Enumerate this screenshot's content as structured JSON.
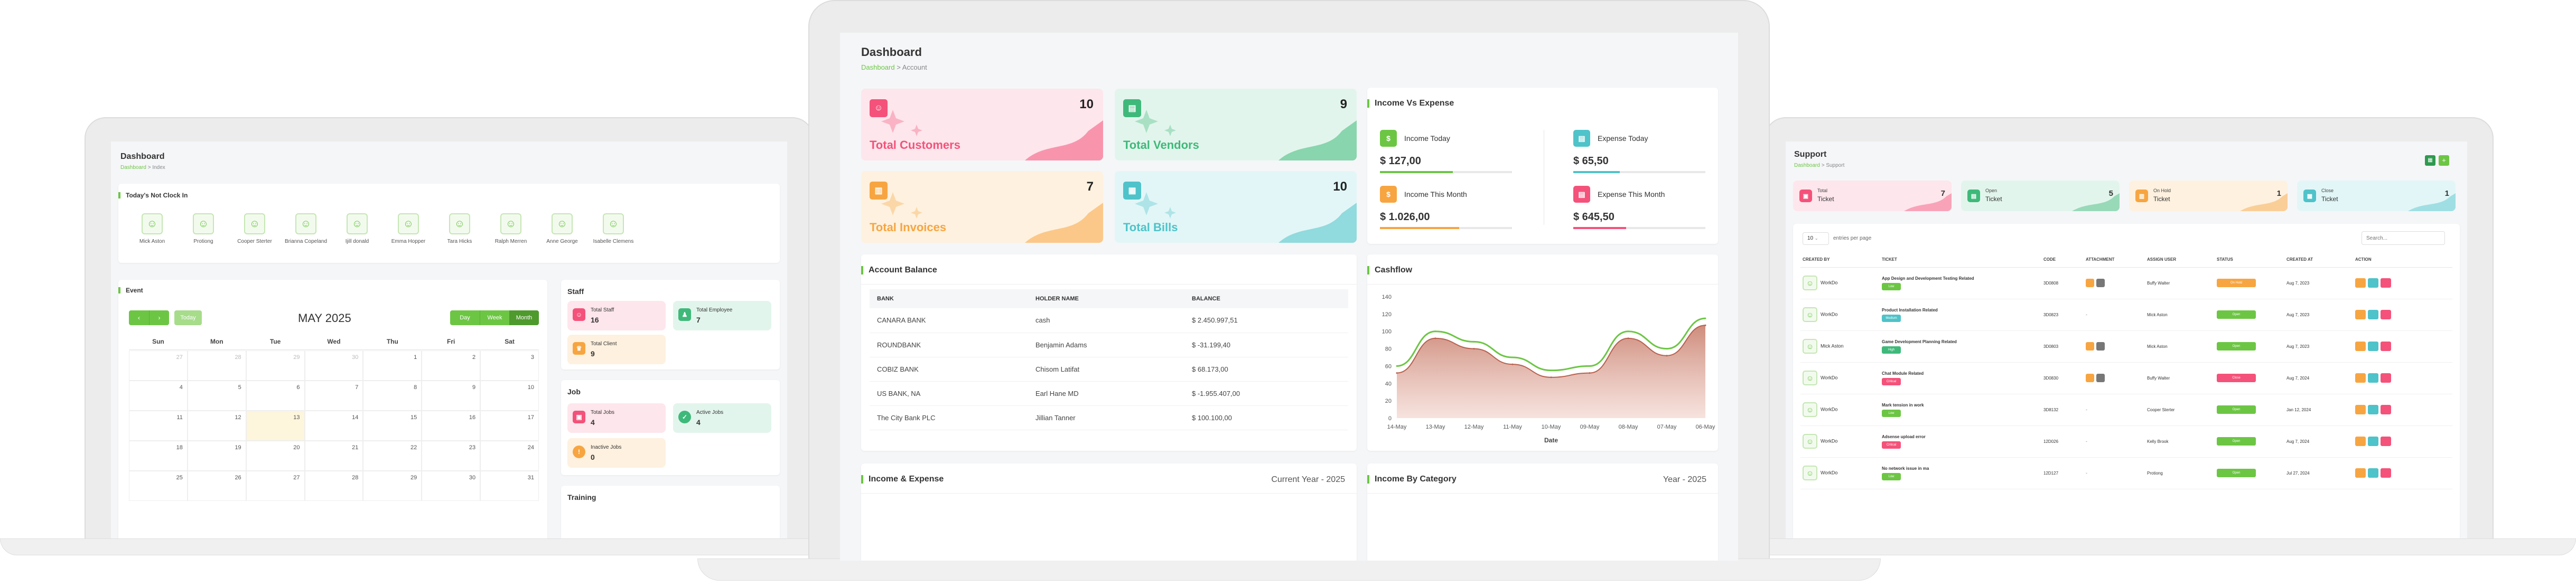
{
  "colors": {
    "accent": "#6cc644",
    "pink": "#f4527a",
    "orange": "#f7a541",
    "teal": "#4ec3c9",
    "grey": "#888888"
  },
  "left": {
    "title": "Dashboard",
    "breadcrumb": [
      "Dashboard",
      "Index"
    ],
    "not_clock": {
      "title": "Today's Not Clock In",
      "people": [
        "Mick Aston",
        "Protiong",
        "Cooper Sterter",
        "Brianna Copeland",
        "Ijill donald",
        "Emma Hopper",
        "Tara Hicks",
        "Ralph Merren",
        "Anne George",
        "Isabelle Clemens"
      ]
    },
    "event": {
      "title": "Event",
      "month": "MAY 2025",
      "today_label": "Today",
      "views": [
        "Day",
        "Week",
        "Month"
      ],
      "weekdays": [
        "Sun",
        "Mon",
        "Tue",
        "Wed",
        "Thu",
        "Fri",
        "Sat"
      ],
      "weeks": [
        [
          "27",
          "28",
          "29",
          "30",
          "1",
          "2",
          "3"
        ],
        [
          "4",
          "5",
          "6",
          "7",
          "8",
          "9",
          "10"
        ],
        [
          "11",
          "12",
          "13",
          "14",
          "15",
          "16",
          "17"
        ],
        [
          "18",
          "19",
          "20",
          "21",
          "22",
          "23",
          "24"
        ],
        [
          "25",
          "26",
          "27",
          "28",
          "29",
          "30",
          "31"
        ]
      ]
    },
    "staff": {
      "title": "Staff",
      "items": [
        {
          "label": "Total Staff",
          "value": "16"
        },
        {
          "label": "Total Employee",
          "value": "7"
        },
        {
          "label": "Total Client",
          "value": "9"
        }
      ]
    },
    "job": {
      "title": "Job",
      "items": [
        {
          "label": "Total Jobs",
          "value": "4"
        },
        {
          "label": "Active Jobs",
          "value": "4"
        },
        {
          "label": "Inactive Jobs",
          "value": "0"
        }
      ]
    },
    "training": {
      "title": "Training"
    }
  },
  "center": {
    "title": "Dashboard",
    "breadcrumb": [
      "Dashboard",
      "Account"
    ],
    "stats": [
      {
        "label": "Total Customers",
        "value": "10"
      },
      {
        "label": "Total Vendors",
        "value": "9"
      },
      {
        "label": "Total Invoices",
        "value": "7"
      },
      {
        "label": "Total Bills",
        "value": "10"
      }
    ],
    "income_expense": {
      "title": "Income Vs Expense",
      "items": [
        {
          "label": "Income Today",
          "value": "$ 127,00"
        },
        {
          "label": "Expense Today",
          "value": "$ 65,50"
        },
        {
          "label": "Income This Month",
          "value": "$ 1.026,00"
        },
        {
          "label": "Expense This Month",
          "value": "$ 645,50"
        }
      ]
    },
    "account_balance": {
      "title": "Account Balance",
      "headers": [
        "BANK",
        "HOLDER NAME",
        "BALANCE"
      ],
      "rows": [
        [
          "CANARA BANK",
          "cash",
          "$ 2.450.997,51"
        ],
        [
          "ROUNDBANK",
          "Benjamin Adams",
          "$ -31.199,40"
        ],
        [
          "COBIZ BANK",
          "Chisom Latifat",
          "$ 68.173,00"
        ],
        [
          "US BANK, NA",
          "Earl Hane MD",
          "$ -1.955.407,00"
        ],
        [
          "The City Bank PLC",
          "Jillian Tanner",
          "$ 100.100,00"
        ]
      ]
    },
    "cashflow": {
      "title": "Cashflow"
    },
    "bottom_left": {
      "title": "Income & Expense",
      "right": "Current Year - 2025"
    },
    "bottom_right": {
      "title": "Income By Category",
      "right": "Year - 2025"
    }
  },
  "chart_data": {
    "type": "area",
    "title": "Cashflow",
    "xlabel": "Date",
    "ylabel": "",
    "ylim": [
      0,
      140
    ],
    "yticks": [
      "140",
      "120",
      "100",
      "80",
      "60",
      "40",
      "20",
      "0"
    ],
    "categories": [
      "14-May",
      "13-May",
      "12-May",
      "11-May",
      "10-May",
      "09-May",
      "08-May",
      "07-May",
      "06-May"
    ],
    "series": [
      {
        "values": [
          60,
          100,
          88,
          70,
          55,
          60,
          100,
          80,
          115
        ]
      },
      {
        "values": [
          52,
          92,
          80,
          62,
          47,
          52,
          92,
          72,
          107
        ]
      }
    ]
  },
  "right": {
    "title": "Support",
    "breadcrumb": [
      "Dashboard",
      "Support"
    ],
    "stats": [
      {
        "small": "Total",
        "label": "Ticket",
        "value": "7"
      },
      {
        "small": "Open",
        "label": "Ticket",
        "value": "5"
      },
      {
        "small": "On Hold",
        "label": "Ticket",
        "value": "1"
      },
      {
        "small": "Close",
        "label": "Ticket",
        "value": "1"
      }
    ],
    "per_page": "10",
    "per_page_label": "entries per page",
    "search_placeholder": "Search...",
    "headers": [
      "CREATED BY",
      "TICKET",
      "CODE",
      "ATTACHMENT",
      "ASSIGN USER",
      "STATUS",
      "CREATED AT",
      "ACTION"
    ],
    "rows": [
      {
        "by": "WorkDo",
        "ticket": "App Design and Development Testing Related",
        "tag": "Low",
        "code": "3D0808",
        "attach": true,
        "assign": "Buffy Walter",
        "status": "On Hold",
        "date": "Aug 7, 2023"
      },
      {
        "by": "WorkDo",
        "ticket": "Product Installation Related",
        "tag": "Medium",
        "code": "3D0823",
        "attach": false,
        "assign": "Mick Aston",
        "status": "Open",
        "date": "Aug 7, 2023"
      },
      {
        "by": "Mick Aston",
        "ticket": "Game Development Planning Related",
        "tag": "High",
        "code": "3D0803",
        "attach": true,
        "assign": "Mick Aston",
        "status": "Open",
        "date": "Aug 7, 2023"
      },
      {
        "by": "WorkDo",
        "ticket": "Chat Module Related",
        "tag": "Critical",
        "code": "3D0830",
        "attach": true,
        "assign": "Buffy Walter",
        "status": "Close",
        "date": "Aug 7, 2024"
      },
      {
        "by": "WorkDo",
        "ticket": "Mark tension in work",
        "tag": "Low",
        "code": "3D8132",
        "attach": false,
        "assign": "Cooper Sterter",
        "status": "Open",
        "date": "Jan 12, 2024"
      },
      {
        "by": "WorkDo",
        "ticket": "Adsense upload error",
        "tag": "Critical",
        "code": "12D026",
        "attach": false,
        "assign": "Kelly Brook",
        "status": "Open",
        "date": "Aug 7, 2024"
      },
      {
        "by": "WorkDo",
        "ticket": "No network issue in ma",
        "tag": "Low",
        "code": "12D127",
        "attach": false,
        "assign": "Protiong",
        "status": "Open",
        "date": "Jul 27, 2024"
      }
    ]
  }
}
